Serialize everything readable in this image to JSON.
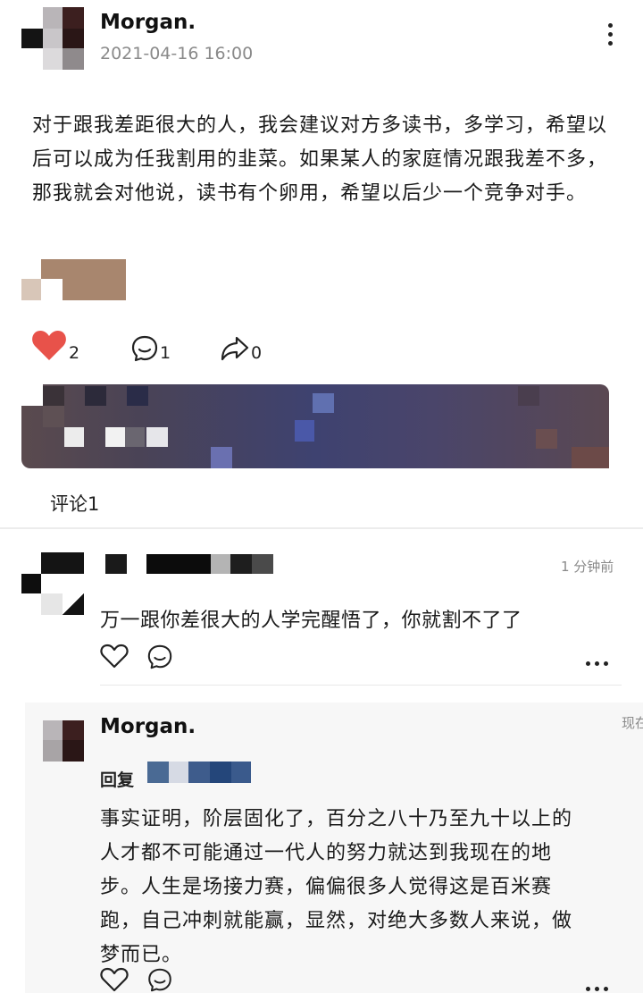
{
  "post": {
    "author": "Morgan.",
    "timestamp": "2021-04-16 16:00",
    "body": "对于跟我差距很大的人，我会建议对方多读书，多学习，希望以后可以成为任我割用的韭菜。如果某人的家庭情况跟我差不多，那我就会对他说，读书有个卵用，希望以后少一个竞争对手。",
    "actions": {
      "like_count": "2",
      "comment_count": "1",
      "share_count": "0"
    }
  },
  "comments_header": "评论1",
  "comments": [
    {
      "time": "1 分钟前",
      "text": "万一跟你差很大的人学完醒悟了，你就割不了了"
    }
  ],
  "reply": {
    "author": "Morgan.",
    "time": "现在",
    "reply_label": "回复",
    "text": "事实证明，阶层固化了，百分之八十乃至九十以上的人才都不可能通过一代人的努力就达到我现在的地步。人生是场接力赛，偏偏很多人觉得这是百米赛跑，自己冲刺就能赢，显然，对绝大多数人来说，做梦而已。"
  },
  "colors": {
    "like_active": "#e8524a",
    "secondary_text": "#8a8a8a",
    "reply_background": "#f7f7f7"
  },
  "icons": [
    "heart-filled-icon",
    "comment-bubble-icon",
    "share-icon",
    "more-vertical-icon",
    "heart-outline-icon",
    "more-horizontal-icon"
  ]
}
